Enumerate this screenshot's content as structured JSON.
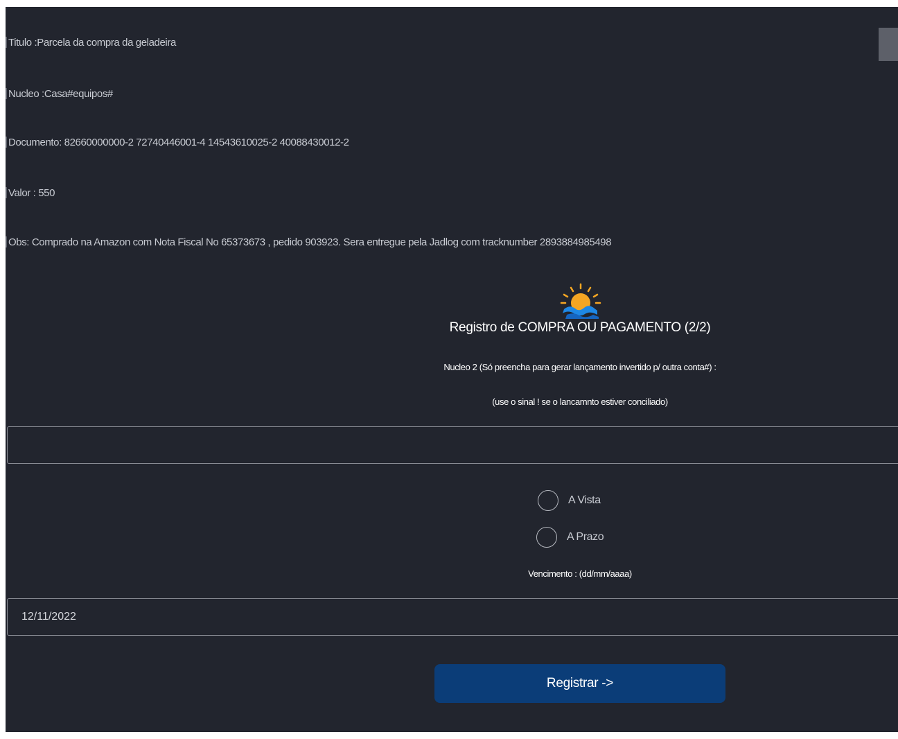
{
  "info": {
    "titulo": "Titulo :Parcela da compra da geladeira",
    "nucleo": "Nucleo :Casa#equipos#",
    "documento": "Documento: 82660000000-2 72740446001-4 14543610025-2 40088430012-2",
    "valor": "Valor : 550",
    "obs": "Obs: Comprado na Amazon com Nota Fiscal No 65373673 , pedido 903923. Sera entregue pela Jadlog com tracknumber 2893884985498"
  },
  "form": {
    "title": "Registro de COMPRA OU PAGAMENTO (2/2)",
    "nucleo2_label": "Nucleo 2 (Só preencha para gerar lançamento invertido p/ outra conta#) :",
    "nucleo2_hint": "(use o sinal ! se o lancamnto estiver conciliado)",
    "nucleo2_value": "",
    "payment_options": [
      {
        "label": "A Vista",
        "selected": false
      },
      {
        "label": "A Prazo",
        "selected": false
      }
    ],
    "vencimento_label": "Vencimento : (dd/mm/aaaa)",
    "vencimento_value": "12/11/2022",
    "submit_label": "Registrar ->"
  },
  "colors": {
    "background": "#22252e",
    "button": "#0b3d78",
    "logo_sun": "#f5a623",
    "logo_wave": "#1e88e5"
  },
  "icons": {
    "logo": "sun-over-waves-icon"
  }
}
